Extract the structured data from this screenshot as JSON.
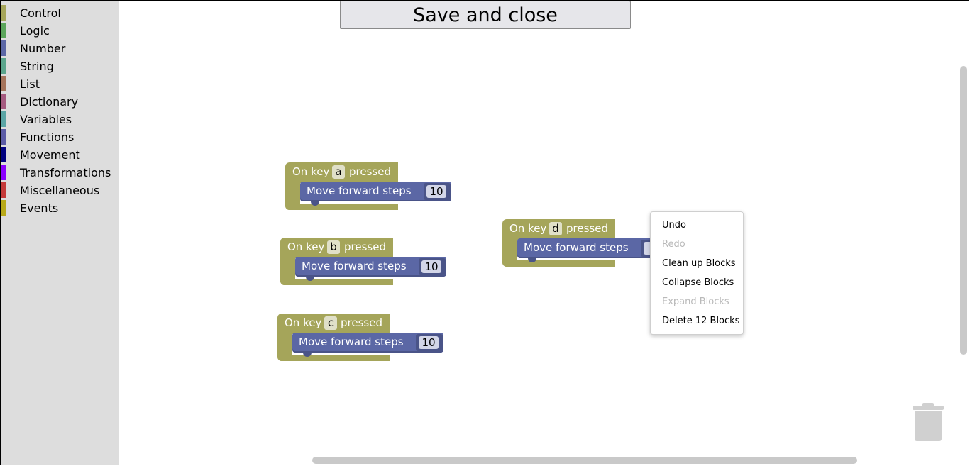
{
  "toolbox": {
    "categories": [
      {
        "label": "Control",
        "color": "#a5a55a"
      },
      {
        "label": "Logic",
        "color": "#5ba55b"
      },
      {
        "label": "Number",
        "color": "#5b67a5"
      },
      {
        "label": "String",
        "color": "#5ba58c"
      },
      {
        "label": "List",
        "color": "#a5745b"
      },
      {
        "label": "Dictionary",
        "color": "#a55b80"
      },
      {
        "label": "Variables",
        "color": "#5ba5a5"
      },
      {
        "label": "Functions",
        "color": "#5b5ba5"
      },
      {
        "label": "Movement",
        "color": "#00007f"
      },
      {
        "label": "Transformations",
        "color": "#8b00ff"
      },
      {
        "label": "Miscellaneous",
        "color": "#c43a3a"
      },
      {
        "label": "Events",
        "color": "#b8a91a"
      }
    ]
  },
  "save_button": {
    "label": "Save and close"
  },
  "workspace": {
    "blocks": [
      {
        "prefix": "On key",
        "key": "a",
        "suffix": "pressed",
        "move_label": "Move forward steps",
        "steps": "10"
      },
      {
        "prefix": "On key",
        "key": "b",
        "suffix": "pressed",
        "move_label": "Move forward steps",
        "steps": "10"
      },
      {
        "prefix": "On key",
        "key": "c",
        "suffix": "pressed",
        "move_label": "Move forward steps",
        "steps": "10"
      },
      {
        "prefix": "On key",
        "key": "d",
        "suffix": "pressed",
        "move_label": "Move forward steps",
        "steps": "1"
      }
    ]
  },
  "context_menu": {
    "items": [
      {
        "label": "Undo",
        "enabled": true
      },
      {
        "label": "Redo",
        "enabled": false
      },
      {
        "label": "Clean up Blocks",
        "enabled": true
      },
      {
        "label": "Collapse Blocks",
        "enabled": true
      },
      {
        "label": "Expand Blocks",
        "enabled": false
      },
      {
        "label": "Delete 12 Blocks",
        "enabled": true
      }
    ]
  },
  "trash": {
    "icon": "trash-icon"
  }
}
